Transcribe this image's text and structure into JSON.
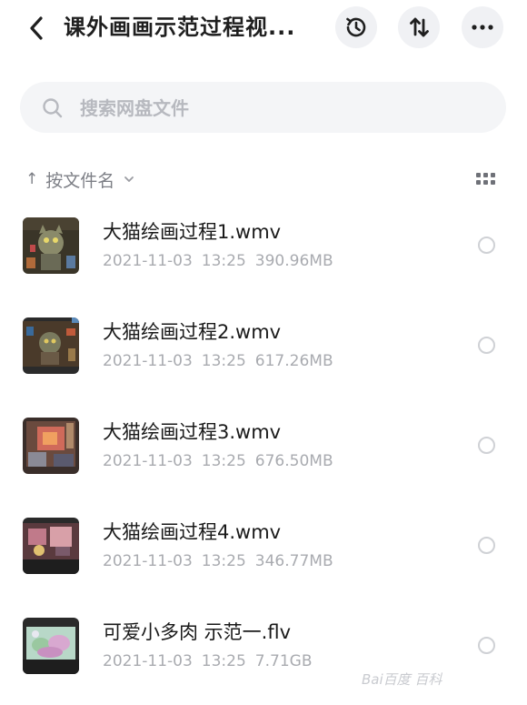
{
  "header": {
    "title": "课外画画示范过程视...",
    "back_icon": "chevron-left-icon",
    "history_icon": "history-icon",
    "sort_icon": "sort-arrows-icon",
    "more_icon": "more-horizontal-icon"
  },
  "search": {
    "placeholder": "搜索网盘文件",
    "value": ""
  },
  "sortbar": {
    "direction_arrow": "↑",
    "label": "按文件名",
    "chevron": "⌄",
    "view_icon": "grid-view-icon"
  },
  "files": [
    {
      "name": "大猫绘画过程1.wmv",
      "date": "2021-11-03",
      "time": "13:25",
      "size": "390.96MB"
    },
    {
      "name": "大猫绘画过程2.wmv",
      "date": "2021-11-03",
      "time": "13:25",
      "size": "617.26MB"
    },
    {
      "name": "大猫绘画过程3.wmv",
      "date": "2021-11-03",
      "time": "13:25",
      "size": "676.50MB"
    },
    {
      "name": "大猫绘画过程4.wmv",
      "date": "2021-11-03",
      "time": "13:25",
      "size": "346.77MB"
    },
    {
      "name": "可爱小多肉 示范一.flv",
      "date": "2021-11-03",
      "time": "13:25",
      "size": "7.71GB"
    }
  ],
  "watermark": "Bai百度 百科"
}
